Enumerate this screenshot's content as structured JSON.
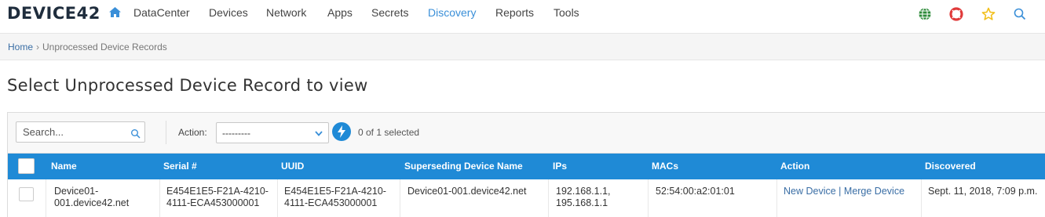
{
  "brand": {
    "logo_text": "DEVICE42"
  },
  "nav": {
    "items": [
      {
        "label": "DataCenter"
      },
      {
        "label": "Devices"
      },
      {
        "label": "Network"
      },
      {
        "label": "Apps"
      },
      {
        "label": "Secrets"
      },
      {
        "label": "Discovery",
        "active": true
      },
      {
        "label": "Reports"
      },
      {
        "label": "Tools"
      }
    ],
    "right_icons": [
      "globe-icon",
      "help-lifebuoy-icon",
      "star-icon",
      "search-icon"
    ]
  },
  "breadcrumb": {
    "home": "Home",
    "separator": "›",
    "current": "Unprocessed Device Records"
  },
  "page": {
    "title": "Select Unprocessed Device Record to view"
  },
  "toolbar": {
    "search_placeholder": "Search...",
    "action_label": "Action:",
    "action_selected": "---------",
    "selected_text": "0 of 1 selected"
  },
  "table": {
    "headers": {
      "name": "Name",
      "serial": "Serial #",
      "uuid": "UUID",
      "superseding": "Superseding Device Name",
      "ips": "IPs",
      "macs": "MACs",
      "action": "Action",
      "discovered": "Discovered"
    },
    "rows": [
      {
        "name_line1": "Device01-",
        "name_line2": "001.device42.net",
        "serial_line1": "E454E1E5-F21A-4210-",
        "serial_line2": "4111-ECA453000001",
        "uuid_line1": "E454E1E5-F21A-4210-",
        "uuid_line2": "4111-ECA453000001",
        "superseding": "Device01-001.device42.net",
        "ips_line1": "192.168.1.1,",
        "ips_line2": "195.168.1.1",
        "macs": "52:54:00:a2:01:01",
        "action_new": "New Device",
        "action_sep": "|",
        "action_merge": "Merge Device",
        "discovered": "Sept. 11, 2018, 7:09 p.m."
      }
    ]
  },
  "colors": {
    "accent": "#1f8ad6",
    "nav_active": "#3a8fd8",
    "link": "#3a6ea5",
    "globe": "#2e8b3a",
    "lifebuoy": "#e03a3a",
    "star": "#f2c01e"
  }
}
